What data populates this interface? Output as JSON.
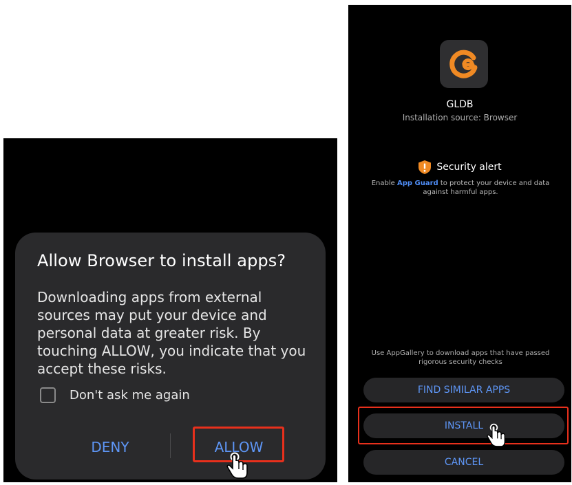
{
  "left_dialog": {
    "title": "Allow Browser to install apps?",
    "body": "Downloading apps from external sources may put your device and personal data at greater risk. By touching ALLOW, you indicate that you accept these risks.",
    "checkbox_label": "Don't ask me again",
    "checkbox_checked": false,
    "deny_label": "DENY",
    "allow_label": "ALLOW"
  },
  "right_installer": {
    "app_icon": "gldb-logo-icon",
    "app_name": "GLDB",
    "source": "Installation source: Browser",
    "alert_icon": "shield-exclamation-icon",
    "alert_title": "Security alert",
    "alert_prefix": "Enable ",
    "alert_link": "App Guard",
    "alert_suffix": " to protect your device and data against harmful apps.",
    "gallery_note": "Use AppGallery to download apps that have passed rigorous security checks",
    "find_similar_label": "FIND SIMILAR APPS",
    "install_label": "INSTALL",
    "cancel_label": "CANCEL"
  },
  "colors": {
    "accent": "#5e96f6",
    "highlight": "#e8301c",
    "icon_orange": "#f08a24",
    "dialog_bg": "#2a2a2c"
  }
}
